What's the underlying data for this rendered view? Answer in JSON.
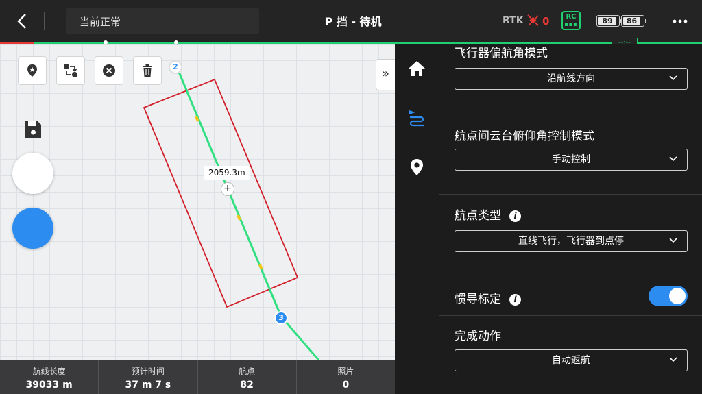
{
  "header": {
    "status": "当前正常",
    "mode_title": "P 挡 - 待机",
    "rtk_label": "RTK",
    "rtk_count": "0",
    "rc_label": "RC",
    "battery_1": "89",
    "battery_2": "86",
    "track_readout": "--:--"
  },
  "map": {
    "distance_label": "2059.3m",
    "waypoint_a": "2",
    "waypoint_b": "3",
    "plus_symbol": "+",
    "collapse_symbol": "»"
  },
  "stats": [
    {
      "label": "航线长度",
      "value": "39033 m"
    },
    {
      "label": "预计时间",
      "value": "37 m 7 s"
    },
    {
      "label": "航点",
      "value": "82"
    },
    {
      "label": "照片",
      "value": "0"
    }
  ],
  "panel": {
    "heading_mode": {
      "title": "飞行器偏航角模式",
      "value": "沿航线方向"
    },
    "gimbal_mode": {
      "title": "航点间云台俯仰角控制模式",
      "value": "手动控制"
    },
    "waypoint_type": {
      "title": "航点类型",
      "value": "直线飞行，飞行器到点停"
    },
    "imu_calibration": {
      "title": "惯导标定",
      "enabled": true
    },
    "finish_action": {
      "title": "完成动作",
      "value": "自动返航"
    },
    "info_symbol": "i"
  },
  "colors": {
    "accent_blue": "#2d8cf0",
    "route_green": "#20d070",
    "area_red": "#d21f2a",
    "alert_red": "#e53935"
  },
  "icons": [
    "back-arrow-icon",
    "satellite-icon",
    "more-icon",
    "pin-star-icon",
    "swap-icon",
    "close-circle-icon",
    "trash-icon",
    "save-icon",
    "play-icon",
    "home-icon",
    "route-icon",
    "location-pin-icon",
    "chevron-down-icon",
    "info-icon"
  ]
}
